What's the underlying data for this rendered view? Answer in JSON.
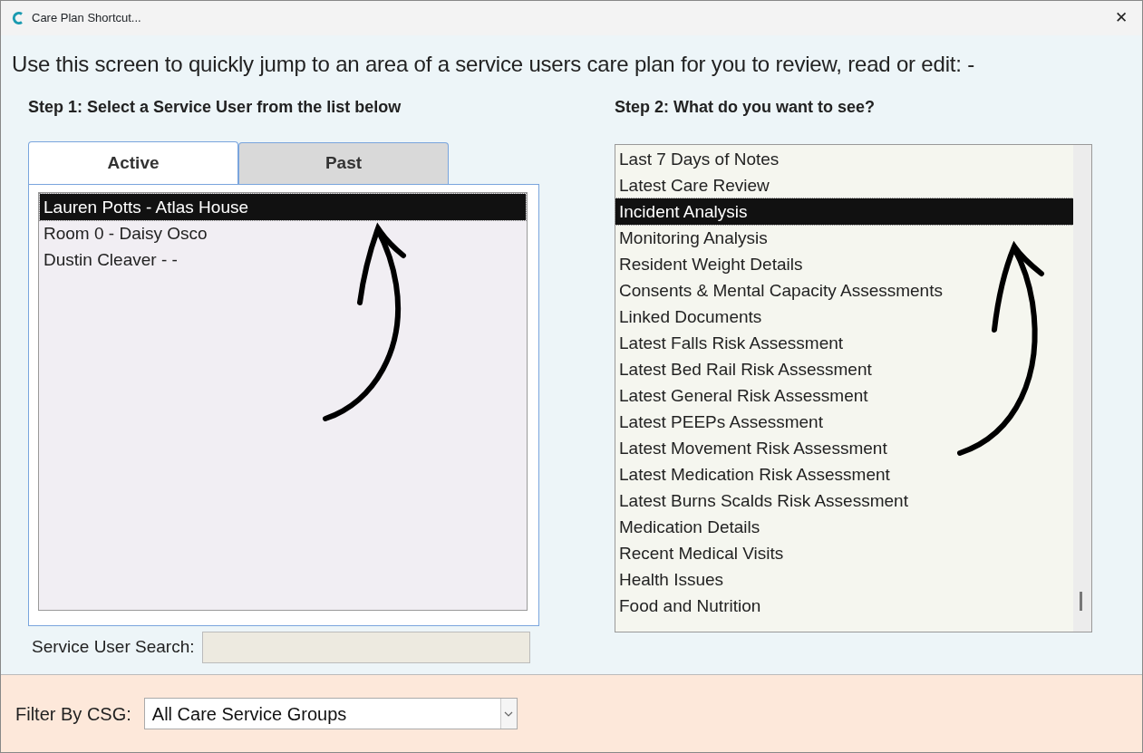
{
  "window": {
    "title": "Care Plan Shortcut...",
    "close": "✕"
  },
  "intro": "Use this screen to quickly jump to an area of a service users care plan for you to review, read or edit: -",
  "step1": {
    "heading": "Step 1: Select a Service User from the list below",
    "tabs": [
      {
        "label": "Active",
        "selected": true
      },
      {
        "label": "Past",
        "selected": false
      }
    ],
    "service_users": [
      {
        "label": "Lauren Potts - Atlas House",
        "selected": true
      },
      {
        "label": "Room 0 - Daisy Osco",
        "selected": false
      },
      {
        "label": "Dustin Cleaver - -",
        "selected": false
      }
    ],
    "search": {
      "label": "Service User Search:"
    }
  },
  "step2": {
    "heading": "Step 2: What do you want to see?",
    "options": [
      {
        "label": "Last 7 Days of Notes",
        "selected": false
      },
      {
        "label": "Latest Care Review",
        "selected": false
      },
      {
        "label": "Incident Analysis",
        "selected": true
      },
      {
        "label": "Monitoring Analysis",
        "selected": false
      },
      {
        "label": "Resident Weight Details",
        "selected": false
      },
      {
        "label": "Consents & Mental Capacity Assessments",
        "selected": false
      },
      {
        "label": "Linked Documents",
        "selected": false
      },
      {
        "label": "Latest Falls Risk Assessment",
        "selected": false
      },
      {
        "label": "Latest Bed Rail Risk Assessment",
        "selected": false
      },
      {
        "label": "Latest General Risk Assessment",
        "selected": false
      },
      {
        "label": "Latest PEEPs Assessment",
        "selected": false
      },
      {
        "label": "Latest Movement Risk Assessment",
        "selected": false
      },
      {
        "label": "Latest Medication Risk Assessment",
        "selected": false
      },
      {
        "label": "Latest Burns Scalds Risk Assessment",
        "selected": false
      },
      {
        "label": "Medication Details",
        "selected": false
      },
      {
        "label": "Recent Medical Visits",
        "selected": false
      },
      {
        "label": "Health Issues",
        "selected": false
      },
      {
        "label": "Food and Nutrition",
        "selected": false
      }
    ]
  },
  "filter": {
    "label": "Filter By CSG:",
    "value": "All Care Service Groups"
  }
}
